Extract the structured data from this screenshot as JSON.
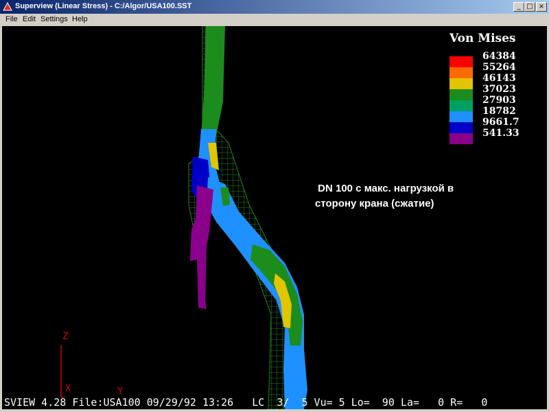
{
  "window": {
    "title": "Superview (Linear Stress) - C:/Algor/USA100.SST",
    "controls": {
      "minimize": "_",
      "maximize": "□",
      "close": "×"
    }
  },
  "menu": {
    "items": [
      {
        "label": "File"
      },
      {
        "label": "Edit"
      },
      {
        "label": "Settings"
      },
      {
        "label": "Help"
      }
    ]
  },
  "legend": {
    "title": "Von Mises",
    "entries": [
      {
        "value": "64384",
        "color": "#ff0000"
      },
      {
        "value": "55264",
        "color": "#ff6a00"
      },
      {
        "value": "46143",
        "color": "#e3c400"
      },
      {
        "value": "37023",
        "color": "#1c8c1c"
      },
      {
        "value": "27903",
        "color": "#00a060"
      },
      {
        "value": "18782",
        "color": "#1e90ff"
      },
      {
        "value": "9661.7",
        "color": "#0000c8"
      },
      {
        "value": "541.33",
        "color": "#8b008b"
      }
    ]
  },
  "annotation": {
    "line1": " DN 100 с макс. нагрузкой в",
    "line2": "сторону крана (сжатие)"
  },
  "axes": {
    "z_label": "Z",
    "x_label": "X",
    "y_label": "Y"
  },
  "status": {
    "text": "SVIEW 4.28 File:USA100 09/29/92 13:26   LC  3/  5 Vu= 5 Lo=  90 La=   0 R=   0"
  }
}
